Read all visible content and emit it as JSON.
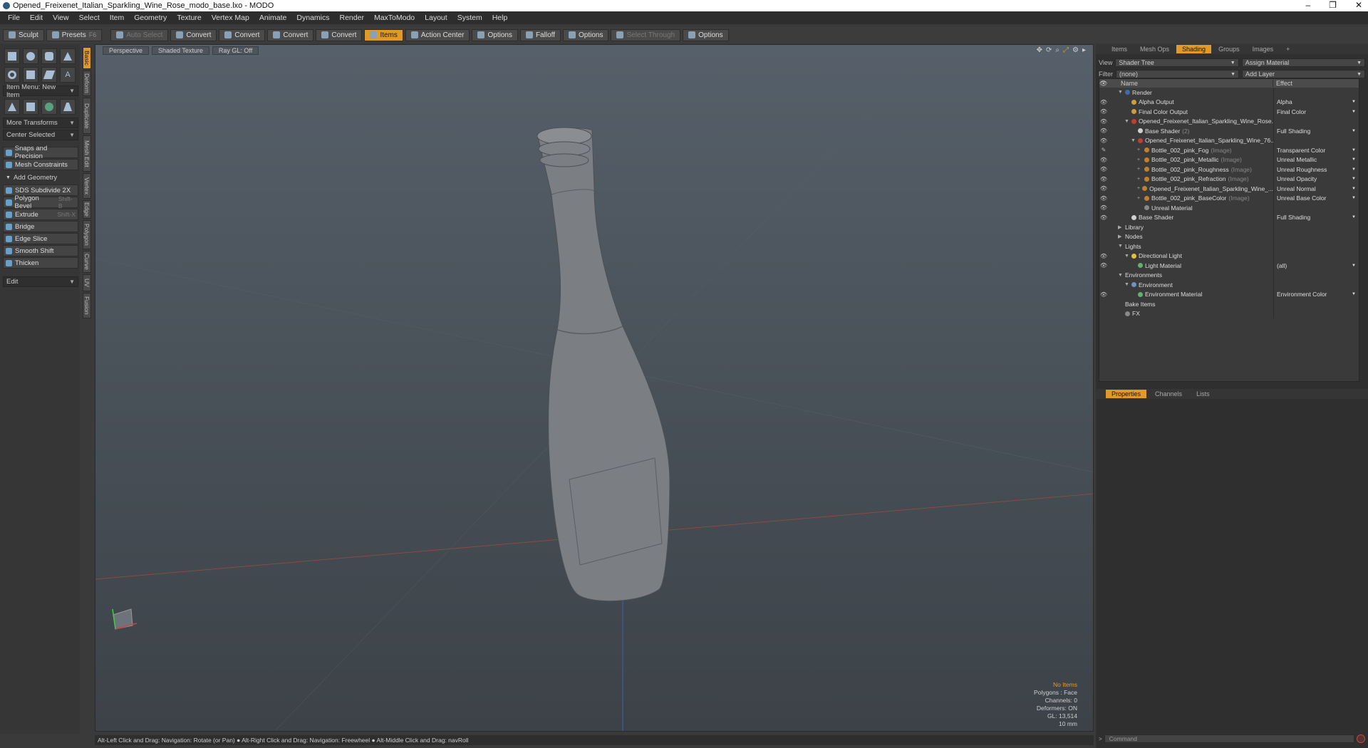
{
  "titlebar": {
    "title": "Opened_Freixenet_Italian_Sparkling_Wine_Rose_modo_base.lxo - MODO",
    "min": "–",
    "max": "❐",
    "close": "✕"
  },
  "menu": [
    "File",
    "Edit",
    "View",
    "Select",
    "Item",
    "Geometry",
    "Texture",
    "Vertex Map",
    "Animate",
    "Dynamics",
    "Render",
    "MaxToModo",
    "Layout",
    "System",
    "Help"
  ],
  "toolbar": {
    "sculpt": "Sculpt",
    "presets": "Presets",
    "presets_shortcut": "F6",
    "auto_select": "Auto Select",
    "convert1": "Convert",
    "convert2": "Convert",
    "convert3": "Convert",
    "convert4": "Convert",
    "items": "Items",
    "action_center": "Action Center",
    "options1": "Options",
    "falloff": "Falloff",
    "options2": "Options",
    "select_through": "Select Through",
    "options3": "Options"
  },
  "left": {
    "item_menu": "Item Menu: New Item",
    "more_transforms": "More Transforms",
    "center_selected": "Center Selected",
    "snaps": "Snaps and Precision",
    "mesh_constraints": "Mesh Constraints",
    "add_geometry": "Add Geometry",
    "sds_subdivide": "SDS Subdivide 2X",
    "polygon_bevel": "Polygon Bevel",
    "polygon_bevel_sc": "Shift-B",
    "extrude": "Extrude",
    "extrude_sc": "Shift-X",
    "bridge": "Bridge",
    "edge_slice": "Edge Slice",
    "smooth_shift": "Smooth Shift",
    "thicken": "Thicken",
    "edit": "Edit"
  },
  "vtabs": [
    "Basic",
    "Deform",
    "Duplicate",
    "Mesh Edit",
    "Vertex",
    "Edge",
    "Polygon",
    "Curve",
    "UV",
    "Fusion"
  ],
  "viewport": {
    "view": "Perspective",
    "shading": "Shaded Texture",
    "raygl": "Ray GL: Off",
    "info": {
      "no_items": "No Items",
      "polygons": "Polygons : Face",
      "channels": "Channels: 0",
      "deformers": "Deformers: ON",
      "gl": "GL: 13,514",
      "scale": "10 mm"
    }
  },
  "status": "Alt-Left Click and Drag: Navigation: Rotate (or Pan) ● Alt-Right Click and Drag: Navigation: Freewheel ● Alt-Middle Click and Drag: navRoll",
  "right": {
    "tabs": [
      "Items",
      "Mesh Ops",
      "Shading",
      "Groups",
      "Images"
    ],
    "view_label": "View",
    "view_value": "Shader Tree",
    "assign_material": "Assign Material",
    "filter_label": "Filter",
    "filter_value": "(none)",
    "add_layer": "Add Layer",
    "col_name": "Name",
    "col_effect": "Effect",
    "rows": [
      {
        "name": "Render",
        "effect": "",
        "indent": 0,
        "dot": "#3d6bb0",
        "eye": "",
        "tri": "▼"
      },
      {
        "name": "Alpha Output",
        "effect": "Alpha",
        "indent": 1,
        "dot": "#c8a040",
        "eye": "👁",
        "tri": ""
      },
      {
        "name": "Final Color Output",
        "effect": "Final Color",
        "indent": 1,
        "dot": "#c8a040",
        "eye": "👁",
        "tri": ""
      },
      {
        "name": "Opened_Freixenet_Italian_Sparkling_Wine_Rose...",
        "effect": "",
        "indent": 1,
        "dot": "#c04030",
        "eye": "👁",
        "tri": "▼"
      },
      {
        "name": "Base Shader",
        "dim": "(2)",
        "effect": "Full Shading",
        "indent": 2,
        "dot": "#d0d0d0",
        "eye": "👁",
        "tri": ""
      },
      {
        "name": "Opened_Freixenet_Italian_Sparkling_Wine_76...",
        "effect": "",
        "indent": 2,
        "dot": "#c04030",
        "eye": "👁",
        "tri": "▼"
      },
      {
        "name": "Bottle_002_pink_Fog",
        "dim": "(Image)",
        "effect": "Transparent Color",
        "indent": 3,
        "dot": "#c08030",
        "eye": "✎",
        "tri": "+"
      },
      {
        "name": "Bottle_002_pink_Metallic",
        "dim": "(Image)",
        "effect": "Unreal Metallic",
        "indent": 3,
        "dot": "#c08030",
        "eye": "👁",
        "tri": "+"
      },
      {
        "name": "Bottle_002_pink_Roughness",
        "dim": "(Image)",
        "effect": "Unreal Roughness",
        "indent": 3,
        "dot": "#c08030",
        "eye": "👁",
        "tri": "+"
      },
      {
        "name": "Bottle_002_pink_Refraction",
        "dim": "(Image)",
        "effect": "Unreal Opacity",
        "indent": 3,
        "dot": "#c08030",
        "eye": "👁",
        "tri": "+"
      },
      {
        "name": "Opened_Freixenet_Italian_Sparkling_Wine_...",
        "effect": "Unreal Normal",
        "indent": 3,
        "dot": "#c08030",
        "eye": "👁",
        "tri": "+"
      },
      {
        "name": "Bottle_002_pink_BaseColor",
        "dim": "(Image)",
        "effect": "Unreal Base Color",
        "indent": 3,
        "dot": "#c08030",
        "eye": "👁",
        "tri": "+"
      },
      {
        "name": "Unreal Material",
        "effect": "",
        "indent": 3,
        "dot": "#888888",
        "eye": "👁",
        "tri": ""
      },
      {
        "name": "Base Shader",
        "effect": "Full Shading",
        "indent": 1,
        "dot": "#d0d0d0",
        "eye": "👁",
        "tri": ""
      },
      {
        "name": "Library",
        "effect": "",
        "indent": 0,
        "dot": "",
        "eye": "",
        "tri": "▶"
      },
      {
        "name": "Nodes",
        "effect": "",
        "indent": 0,
        "dot": "",
        "eye": "",
        "tri": "▶"
      },
      {
        "name": "Lights",
        "effect": "",
        "indent": 0,
        "dot": "",
        "eye": "",
        "tri": "▼"
      },
      {
        "name": "Directional Light",
        "effect": "",
        "indent": 1,
        "dot": "#e0c040",
        "eye": "👁",
        "tri": "▼"
      },
      {
        "name": "Light Material",
        "effect": "(all)",
        "indent": 2,
        "dot": "#60b070",
        "eye": "👁",
        "tri": ""
      },
      {
        "name": "Environments",
        "effect": "",
        "indent": 0,
        "dot": "",
        "eye": "",
        "tri": "▼"
      },
      {
        "name": "Environment",
        "effect": "",
        "indent": 1,
        "dot": "#7090c0",
        "eye": "",
        "tri": "▼"
      },
      {
        "name": "Environment Material",
        "effect": "Environment Color",
        "indent": 2,
        "dot": "#60b070",
        "eye": "👁",
        "tri": ""
      },
      {
        "name": "Bake Items",
        "effect": "",
        "indent": 0,
        "dot": "",
        "eye": "",
        "tri": ""
      },
      {
        "name": "FX",
        "effect": "",
        "indent": 0,
        "dot": "#888888",
        "eye": "",
        "tri": ""
      }
    ],
    "prop_tabs": [
      "Properties",
      "Channels",
      "Lists"
    ],
    "command_placeholder": "Command"
  }
}
